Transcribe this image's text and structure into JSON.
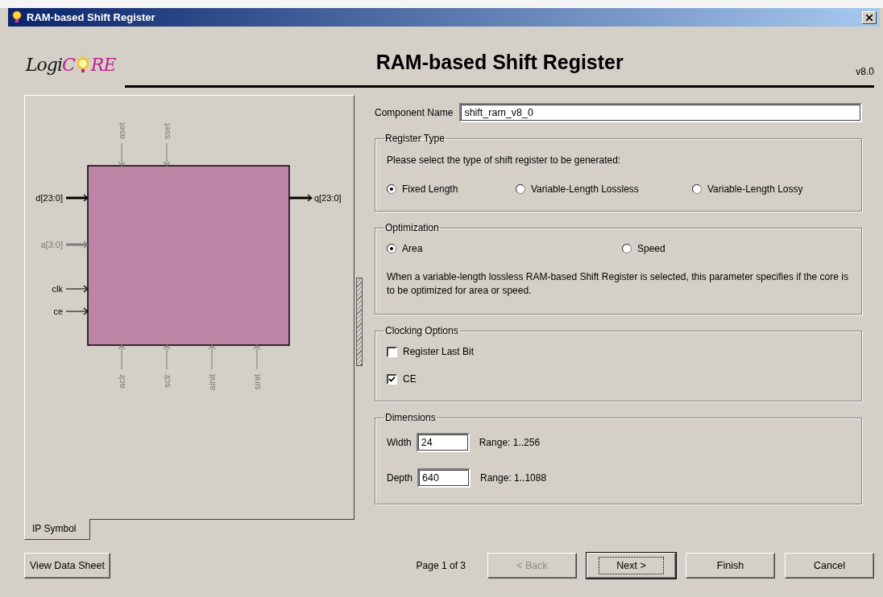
{
  "window": {
    "title": "RAM-based Shift Register"
  },
  "header": {
    "logo": {
      "prefix": "Logi",
      "letter": "C",
      "suffix": "RE"
    },
    "title": "RAM-based Shift Register",
    "version": "v8.0"
  },
  "symbol": {
    "tab": "IP Symbol",
    "top_pins": [
      {
        "name": "aset",
        "bus": false,
        "enabled": false
      },
      {
        "name": "sset",
        "bus": false,
        "enabled": false
      }
    ],
    "left_pins": [
      {
        "name": "d[23:0]",
        "bus": true,
        "enabled": true
      },
      {
        "name": "a[3:0]",
        "bus": true,
        "enabled": false
      },
      {
        "name": "clk",
        "bus": false,
        "enabled": true
      },
      {
        "name": "ce",
        "bus": false,
        "enabled": true
      }
    ],
    "right_pins": [
      {
        "name": "q[23:0]",
        "bus": true,
        "enabled": true
      }
    ],
    "bottom_pins": [
      {
        "name": "aclr",
        "bus": false,
        "enabled": false
      },
      {
        "name": "sclr",
        "bus": false,
        "enabled": false
      },
      {
        "name": "ainit",
        "bus": false,
        "enabled": false
      },
      {
        "name": "sinit",
        "bus": false,
        "enabled": false
      }
    ]
  },
  "form": {
    "component_name": {
      "label": "Component Name",
      "value": "shift_ram_v8_0"
    },
    "groups": [
      {
        "title": "Register Type",
        "items": [
          {
            "kind": "text",
            "text": "Please select the type of shift register to be generated:"
          },
          {
            "kind": "radios",
            "options": [
              {
                "label": "Fixed Length",
                "selected": true
              },
              {
                "label": "Variable-Length Lossless",
                "selected": false
              },
              {
                "label": "Variable-Length Lossy",
                "selected": false
              }
            ]
          }
        ]
      },
      {
        "title": "Optimization",
        "items": [
          {
            "kind": "radios",
            "options": [
              {
                "label": "Area",
                "selected": true
              },
              {
                "label": "Speed",
                "selected": false
              }
            ]
          },
          {
            "kind": "text",
            "text": "When a variable-length lossless RAM-based Shift Register is selected, this parameter specifies if the core is to be optimized for area or speed."
          }
        ]
      },
      {
        "title": "Clocking Options",
        "items": [
          {
            "kind": "checkbox",
            "label": "Register Last Bit",
            "checked": false
          },
          {
            "kind": "checkbox",
            "label": "CE",
            "checked": true
          }
        ]
      },
      {
        "title": "Dimensions",
        "items": [
          {
            "kind": "field",
            "label": "Width",
            "value": "24",
            "range": "Range: 1..256"
          },
          {
            "kind": "field",
            "label": "Depth",
            "value": "640",
            "range": "Range: 1..1088"
          }
        ]
      }
    ]
  },
  "footer": {
    "datasheet_button": "View Data Sheet",
    "page": "Page 1 of 3",
    "buttons": [
      {
        "label": "< Back",
        "disabled": true,
        "default": false
      },
      {
        "label": "Next >",
        "disabled": false,
        "default": true
      },
      {
        "label": "Finish",
        "disabled": false,
        "default": false
      },
      {
        "label": "Cancel",
        "disabled": false,
        "default": false
      }
    ]
  }
}
